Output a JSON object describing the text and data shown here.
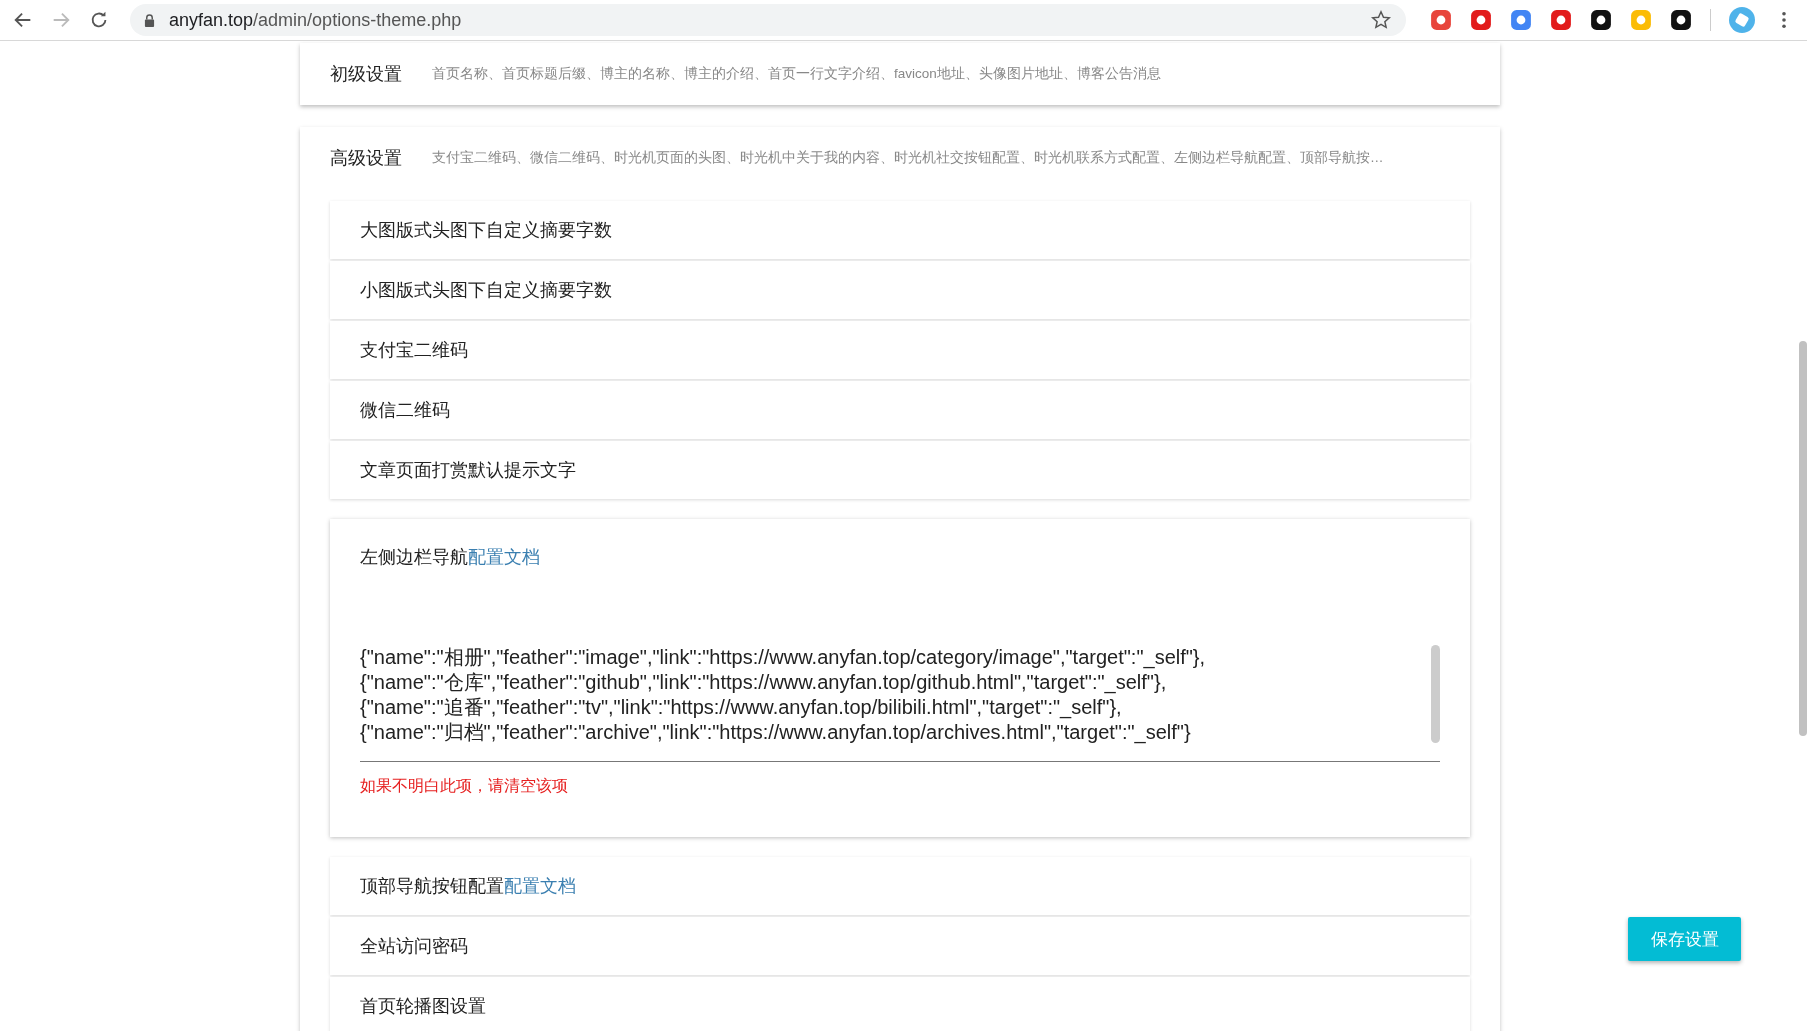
{
  "browser": {
    "url_host": "anyfan.top",
    "url_path": "/admin/options-theme.php",
    "forward_disabled": true
  },
  "sections": [
    {
      "title": "初级设置",
      "description": "首页名称、首页标题后缀、博主的名称、博主的介绍、首页一行文字介绍、favicon地址、头像图片地址、博客公告消息",
      "expanded": false
    },
    {
      "title": "高级设置",
      "description": "支付宝二维码、微信二维码、时光机页面的头图、时光机中关于我的内容、时光机社交按钮配置、时光机联系方式配置、左侧边栏导航配置、顶部导航按…",
      "expanded": true,
      "items": [
        {
          "kind": "row",
          "label": "大图版式头图下自定义摘要字数"
        },
        {
          "kind": "row",
          "label": "小图版式头图下自定义摘要字数"
        },
        {
          "kind": "row",
          "label": "支付宝二维码"
        },
        {
          "kind": "row",
          "label": "微信二维码"
        },
        {
          "kind": "row",
          "label": "文章页面打赏默认提示文字"
        },
        {
          "kind": "textarea",
          "label": "左侧边栏导航",
          "link": "配置文档",
          "lines": [
            "{\"name\":\"相册\",\"feather\":\"image\",\"link\":\"https://www.anyfan.top/category/image\",\"target\":\"_self\"},",
            "{\"name\":\"仓库\",\"feather\":\"github\",\"link\":\"https://www.anyfan.top/github.html\",\"target\":\"_self\"},",
            "{\"name\":\"追番\",\"feather\":\"tv\",\"link\":\"https://www.anyfan.top/bilibili.html\",\"target\":\"_self\"},",
            "{\"name\":\"归档\",\"feather\":\"archive\",\"link\":\"https://www.anyfan.top/archives.html\",\"target\":\"_self\"}"
          ],
          "hint": "如果不明白此项，请清空该项"
        },
        {
          "kind": "row",
          "label": "顶部导航按钮配置",
          "link": "配置文档"
        },
        {
          "kind": "row",
          "label": "全站访问密码"
        },
        {
          "kind": "row",
          "label": "首页轮播图设置"
        }
      ]
    }
  ],
  "save_button": "保存设置"
}
